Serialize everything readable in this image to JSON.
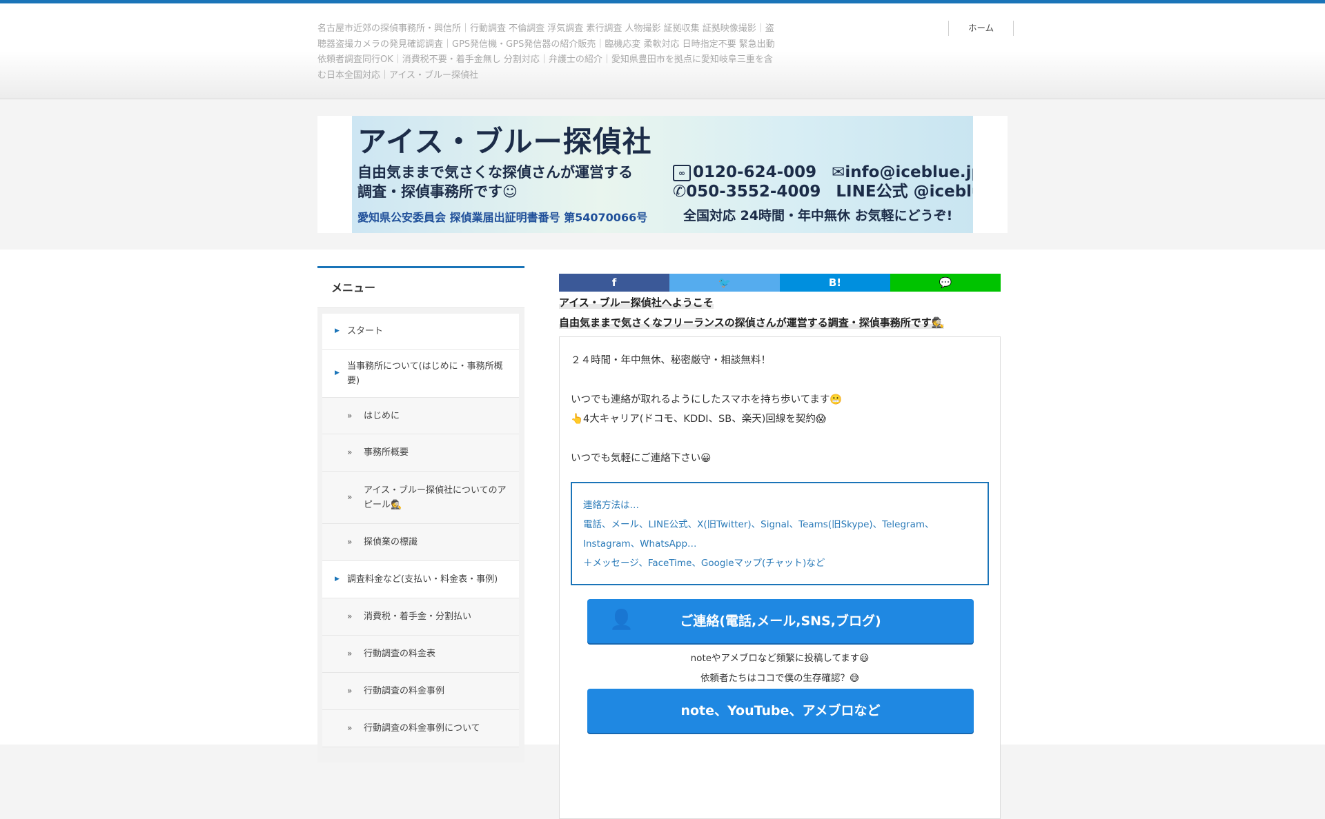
{
  "header": {
    "site_description": "名古屋市近郊の探偵事務所・興信所｜行動調査 不倫調査 浮気調査 素行調査 人物撮影 証拠収集 証拠映像撮影｜盗聴器盗撮カメラの発見確認調査｜GPS発信機・GPS発信器の紹介販売｜臨機応変 柔軟対応 日時指定不要 緊急出動 依頼者調査同行OK｜消費税不要・着手金無し 分割対応｜弁護士の紹介｜愛知県豊田市を拠点に愛知岐阜三重を含む日本全国対応｜アイス・ブルー探偵社",
    "nav": [
      {
        "label": "ホーム"
      }
    ]
  },
  "banner": {
    "title": "アイス・ブルー探偵社",
    "tagline_1": "自由気ままで気さくな探偵さんが運営する",
    "tagline_2": "調査・探偵事務所です☺",
    "license": "愛知県公安委員会 探偵業届出証明書番号 第54070066号",
    "freedial_icon": "free-dial-icon",
    "freedial": "0120-624-009",
    "email": "✉info@iceblue.jp",
    "phone": "✆050-3552-4009",
    "line": "LINE公式 @iceblue",
    "availability": "全国対応 24時間・年中無休 お気軽にどうぞ!"
  },
  "sidebar": {
    "title": "メニュー",
    "items": [
      {
        "label": "スタート",
        "level": "top"
      },
      {
        "label": "当事務所について(はじめに・事務所概要)",
        "level": "top"
      },
      {
        "label": "はじめに",
        "level": "sub"
      },
      {
        "label": "事務所概要",
        "level": "sub"
      },
      {
        "label": "アイス・ブルー探偵社についてのアピール🕵",
        "level": "sub"
      },
      {
        "label": "探偵業の標識",
        "level": "sub"
      },
      {
        "label": "調査料金など(支払い・料金表・事例)",
        "level": "top"
      },
      {
        "label": "消費税・着手金・分割払い",
        "level": "sub"
      },
      {
        "label": "行動調査の料金表",
        "level": "sub"
      },
      {
        "label": "行動調査の料金事例",
        "level": "sub"
      },
      {
        "label": "行動調査の料金事例について",
        "level": "sub"
      }
    ]
  },
  "share": {
    "facebook": "f",
    "twitter": "🐦",
    "hatena": "B!",
    "line": "💬"
  },
  "main": {
    "welcome_1": "アイス・ブルー探偵社へようこそ",
    "welcome_2": "自由気ままで気さくなフリーランスの探偵さんが運営する調査・探偵事務所です🕵",
    "p1": "２４時間・年中無休、秘密厳守・相談無料！",
    "p2": "いつでも連絡が取れるようにしたスマホを持ち歩いてます😬",
    "p3": "👆4大キャリア(ドコモ、KDDI、SB、楽天)回線を契約😱",
    "p4": "いつでも気軽にご連絡下さい😀",
    "contact_1": "連絡方法は…",
    "contact_2": "電話、メール、LINE公式、X(旧Twitter)、Signal、Teams(旧Skype)、Telegram、Instagram、WhatsApp…",
    "contact_3": "＋メッセージ、FaceTime、Googleマップ(チャット)など",
    "button_1": "ご連絡(電話,メール,SNS,ブログ)",
    "note_1": "noteやアメブロなど頻繁に投稿してます😃",
    "note_2": "依頼者たちはココで僕の生存確認？😅",
    "button_2": "note、YouTube、アメブロなど"
  }
}
